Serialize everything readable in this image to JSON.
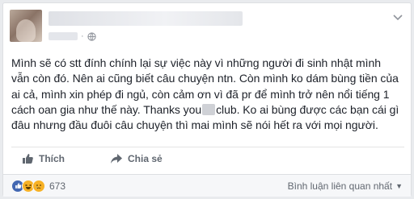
{
  "post": {
    "body_lines": [
      "Mình sẽ có stt đính chính lại sự việc này vì những người đi sinh nhật mình",
      "vẫn còn đó. Nên ai cũng biết câu chuyện ntn. Còn mình ko dám bùng tiền của",
      "ai cả, mình xin phép đi ngủ, còn cảm ơn vì đã pr để mình trở nên nổi tiếng 1",
      "cách oan gia như thế này. Thanks you",
      "club. Ko ai bùng được các bạn cái gì",
      "đâu nhưng đầu đuôi câu chuyện thì mai mình sẽ nói hết ra với mọi người."
    ]
  },
  "actions": {
    "like_label": "Thích",
    "share_label": "Chia sẻ"
  },
  "footer": {
    "reaction_icons": [
      "like-icon",
      "haha-icon",
      "sad-icon"
    ],
    "reaction_count": "673",
    "sort_label": "Bình luận liên quan nhất",
    "sort_caret": "▼"
  },
  "colors": {
    "accent": "#4267b2",
    "text": "#1d2129",
    "muted": "#606770"
  }
}
